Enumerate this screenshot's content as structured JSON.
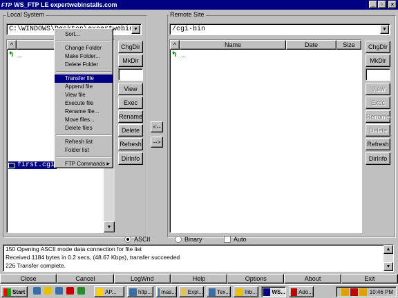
{
  "window": {
    "logo": "FTP",
    "title": "WS_FTP LE  expertwebinstalls.com",
    "controls": [
      "_",
      "▫",
      "×"
    ]
  },
  "local": {
    "label": "Local System",
    "path": "C:\\WINDOWS\\Desktop\\expertwebins",
    "header_arrow": "^",
    "up_entry": "..",
    "file": "first.cgi"
  },
  "remote": {
    "label": "Remote Site",
    "path": "/cgi-bin",
    "header_arrow": "^",
    "columns": [
      "Name",
      "Date",
      "Size"
    ],
    "up_entry": ".."
  },
  "local_buttons": [
    "ChgDir",
    "MkDir",
    "",
    "View",
    "Exec",
    "Rename",
    "Delete",
    "Refresh",
    "DirInfo"
  ],
  "remote_buttons": [
    "ChgDir",
    "MkDir",
    "",
    "View",
    "Exec",
    "Rename",
    "Delete",
    "Refresh",
    "DirInfo"
  ],
  "transfer": {
    "left": "<--",
    "right": "-->"
  },
  "context_menu": {
    "group1": [
      "Sort..."
    ],
    "group2": [
      "Change Folder",
      "Make Folder...",
      "Delete Folder"
    ],
    "group3": [
      "Transfer file",
      "Append file",
      "View file",
      "Execute file",
      "Rename file...",
      "Move files...",
      "Delete files"
    ],
    "group4": [
      "Refresh list",
      "Folder list"
    ],
    "group5": [
      "FTP Commands"
    ],
    "submenu_arrow": "▶",
    "selected": "Transfer file"
  },
  "mode": {
    "ascii": "ASCII",
    "binary": "Binary",
    "auto": "Auto",
    "selected": "ASCII"
  },
  "log": [
    "150 Opening ASCII mode data connection for file list",
    "Received 1184 bytes in 0.2 secs, (48.67 Kbps), transfer succeeded",
    "226 Transfer complete."
  ],
  "bottom_buttons": [
    "Close",
    "Cancel",
    "LogWnd",
    "Help",
    "Options",
    "About",
    "Exit"
  ],
  "taskbar": {
    "start": "Start",
    "tasks": [
      "AP...",
      "http...",
      "mas...",
      "Expl...",
      "Tex...",
      "Inb...",
      "WS...",
      "Ado..."
    ],
    "active_task": "WS...",
    "clock": "10:46 PM"
  },
  "colors": {
    "titlebar": "#000080",
    "face": "#c0c0c0",
    "selection": "#000080",
    "folder_arrow": "#008000"
  }
}
